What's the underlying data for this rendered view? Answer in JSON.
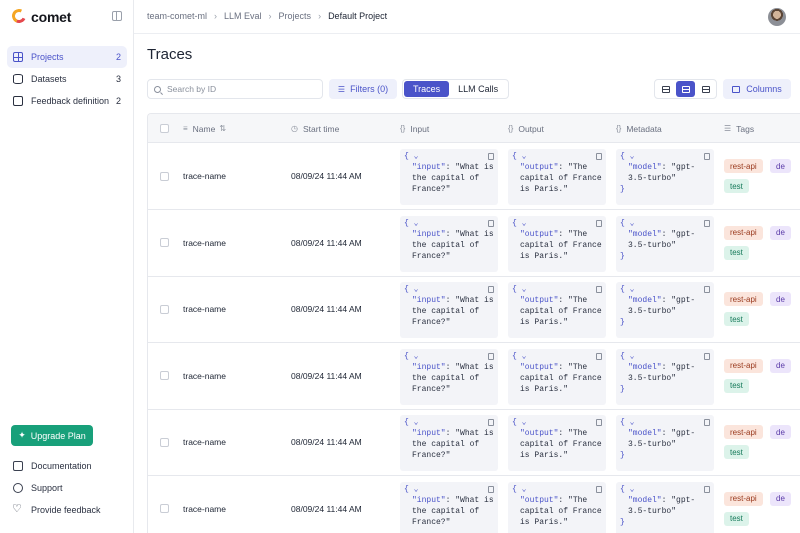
{
  "app": {
    "name": "comet"
  },
  "sidebar": {
    "items": [
      {
        "label": "Projects",
        "count": "2",
        "icon": "grid-icon"
      },
      {
        "label": "Datasets",
        "count": "3",
        "icon": "database-icon"
      },
      {
        "label": "Feedback definition",
        "count": "2",
        "icon": "message-icon"
      }
    ],
    "upgrade_label": "Upgrade Plan",
    "bottom": [
      {
        "label": "Documentation",
        "icon": "book-icon"
      },
      {
        "label": "Support",
        "icon": "chat-icon"
      },
      {
        "label": "Provide feedback",
        "icon": "heart-icon"
      }
    ]
  },
  "breadcrumb": [
    "team-comet-ml",
    "LLM Eval",
    "Projects",
    "Default Project"
  ],
  "page": {
    "title": "Traces"
  },
  "toolbar": {
    "search_placeholder": "Search by ID",
    "filters_label": "Filters (0)",
    "segments": [
      "Traces",
      "LLM Calls"
    ],
    "active_segment": "Traces",
    "columns_label": "Columns"
  },
  "table": {
    "headers": {
      "name": "Name",
      "start_time": "Start time",
      "input": "Input",
      "output": "Output",
      "metadata": "Metadata",
      "tags": "Tags"
    },
    "rows": [
      {
        "name": "trace-name",
        "start_time": "08/09/24 11:44 AM",
        "input_key": "\"input\"",
        "input_val": "\"What is the capital of France?\"",
        "output_key": "\"output\"",
        "output_val": "\"The capital of France is Paris.\"",
        "meta_key": "\"model\"",
        "meta_val": "\"gpt-3.5-turbo\"",
        "tags": [
          "rest-api",
          "de",
          "test"
        ]
      },
      {
        "name": "trace-name",
        "start_time": "08/09/24 11:44 AM",
        "input_key": "\"input\"",
        "input_val": "\"What is the capital of France?\"",
        "output_key": "\"output\"",
        "output_val": "\"The capital of France is Paris.\"",
        "meta_key": "\"model\"",
        "meta_val": "\"gpt-3.5-turbo\"",
        "tags": [
          "rest-api",
          "de",
          "test"
        ]
      },
      {
        "name": "trace-name",
        "start_time": "08/09/24 11:44 AM",
        "input_key": "\"input\"",
        "input_val": "\"What is the capital of France?\"",
        "output_key": "\"output\"",
        "output_val": "\"The capital of France is Paris.\"",
        "meta_key": "\"model\"",
        "meta_val": "\"gpt-3.5-turbo\"",
        "tags": [
          "rest-api",
          "de",
          "test"
        ]
      },
      {
        "name": "trace-name",
        "start_time": "08/09/24 11:44 AM",
        "input_key": "\"input\"",
        "input_val": "\"What is the capital of France?\"",
        "output_key": "\"output\"",
        "output_val": "\"The capital of France is Paris.\"",
        "meta_key": "\"model\"",
        "meta_val": "\"gpt-3.5-turbo\"",
        "tags": [
          "rest-api",
          "de",
          "test"
        ]
      },
      {
        "name": "trace-name",
        "start_time": "08/09/24 11:44 AM",
        "input_key": "\"input\"",
        "input_val": "\"What is the capital of France?\"",
        "output_key": "\"output\"",
        "output_val": "\"The capital of France is Paris.\"",
        "meta_key": "\"model\"",
        "meta_val": "\"gpt-3.5-turbo\"",
        "tags": [
          "rest-api",
          "de",
          "test"
        ]
      },
      {
        "name": "trace-name",
        "start_time": "08/09/24 11:44 AM",
        "input_key": "\"input\"",
        "input_val": "\"What is the capital of France?\"",
        "output_key": "\"output\"",
        "output_val": "\"The capital of France is Paris.\"",
        "meta_key": "\"model\"",
        "meta_val": "\"gpt-3.5-turbo\"",
        "tags": [
          "rest-api",
          "de",
          "test"
        ]
      }
    ]
  },
  "colors": {
    "accent": "#4a53c9",
    "upgrade": "#18a07a"
  }
}
